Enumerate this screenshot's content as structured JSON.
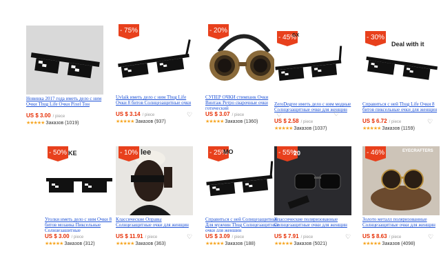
{
  "products": [
    {
      "badge": "",
      "title": "Новинка 2017 года иметь дело с ним Очки Thug Life Очки Pixel Тон",
      "price": "US $ 3.00",
      "piece": "/ piece",
      "stars": "★★★★★",
      "orders": "Заказов (1019)"
    },
    {
      "badge": "- 75%",
      "title": "Uvlaik иметь дело с ним Thug Life Очки 8 битов Солнцезащитные очки",
      "price": "US $ 3.14",
      "piece": "/ piece",
      "stars": "★★★★★",
      "orders": "Заказов (937)"
    },
    {
      "badge": "- 20%",
      "title": "СУПЕР ОЧКИ стимпанк Очки Винтаж Ретро сварочные очки готический",
      "price": "US $ 3.07",
      "piece": "/ piece",
      "stars": "★★★★★",
      "orders": "Заказов (1360)"
    },
    {
      "badge": "- 45%",
      "image_text": "GX",
      "title": "ZeroDegree иметь дело с ним модные Солнцезащитные очки для женщин",
      "price": "US $ 2.58",
      "piece": "/ piece",
      "stars": "★★★★★",
      "orders": "Заказов (1037)"
    },
    {
      "badge": "- 30%",
      "image_text": "Deal with it",
      "title": "Справиться с ней Thug Life Очки 8 битов пиксельные очки для женщин",
      "price": "US $ 6.72",
      "piece": "/ piece",
      "stars": "★★★★★",
      "orders": "Заказов (1159)"
    },
    {
      "badge": "- 50%",
      "image_text": "KE",
      "title": "Уголки иметь дело с ним Очки 8 битов мозаика Пиксельные Солнцезащитные",
      "price": "US $ 3.00",
      "piece": "/ piece",
      "stars": "★★★★★",
      "orders": "Заказов (312)"
    },
    {
      "badge": "- 10%",
      "image_text": "lee",
      "title": "Классические Оправы Солнцезащитные очки для женщин",
      "price": "US $ 11.91",
      "piece": "/ piece",
      "stars": "★★★★★",
      "orders": "Заказов (363)"
    },
    {
      "badge": "- 25%",
      "image_text": "MO",
      "title": "Справиться с ней Солнцезащитные Для мужчин Thug Солнцезащитные очки для женщин",
      "price": "US $ 3.09",
      "piece": "/ piece",
      "stars": "★★★★★",
      "orders": "Заказов (188)"
    },
    {
      "badge": "- 55%",
      "image_text": "20",
      "title": "Классические поляризованные Солнцезащитные очки для женщин",
      "price": "US $ 7.91",
      "piece": "/ piece",
      "stars": "★★★★★",
      "orders": "Заказов (5021)"
    },
    {
      "badge": "- 46%",
      "image_text": "EYECRAFTERS",
      "title": "Золото металл поляризованные Солнцезащитные очки для женщин",
      "price": "US $ 8.63",
      "piece": "/ piece",
      "stars": "★★★★★",
      "orders": "Заказов (4098)"
    }
  ],
  "favorite_icon": "heart-outline-icon"
}
